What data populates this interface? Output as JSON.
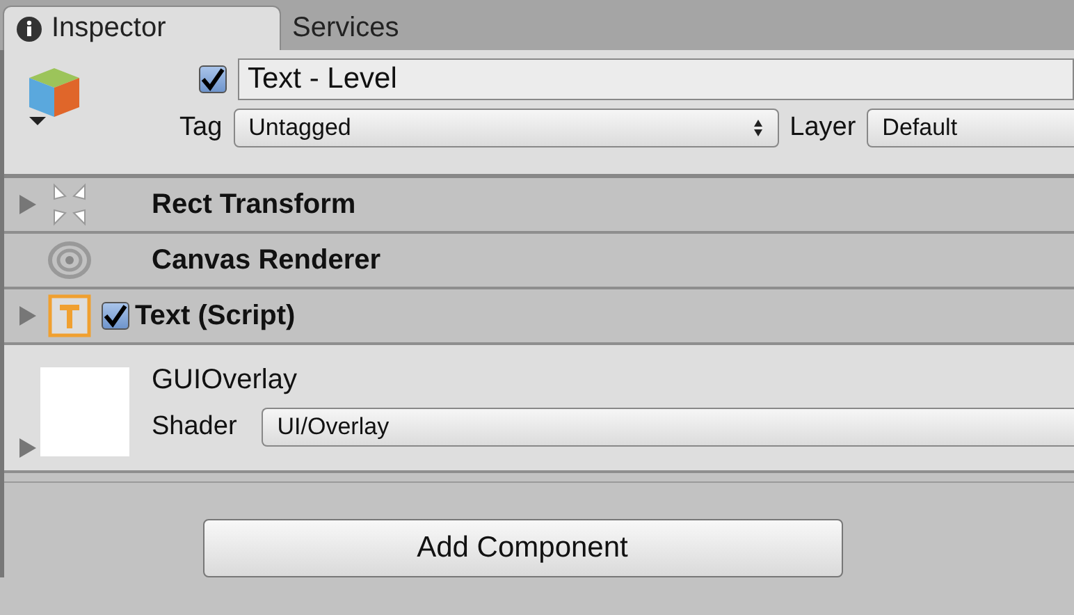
{
  "tabs": [
    {
      "label": "Inspector",
      "selected": true
    },
    {
      "label": "Services",
      "selected": false
    }
  ],
  "object": {
    "active": true,
    "name": "Text - Level",
    "tag_label": "Tag",
    "tag": "Untagged",
    "layer_label": "Layer",
    "layer": "Default"
  },
  "components": [
    {
      "kind": "rect-transform",
      "name": "Rect Transform",
      "expanded": false
    },
    {
      "kind": "canvas-renderer",
      "name": "Canvas Renderer"
    },
    {
      "kind": "text",
      "name": "Text (Script)",
      "expanded": false,
      "enabled": true
    }
  ],
  "material": {
    "name": "GUIOverlay",
    "expanded": false,
    "shader_label": "Shader",
    "shader": "UI/Overlay"
  },
  "add_button": "Add Component"
}
